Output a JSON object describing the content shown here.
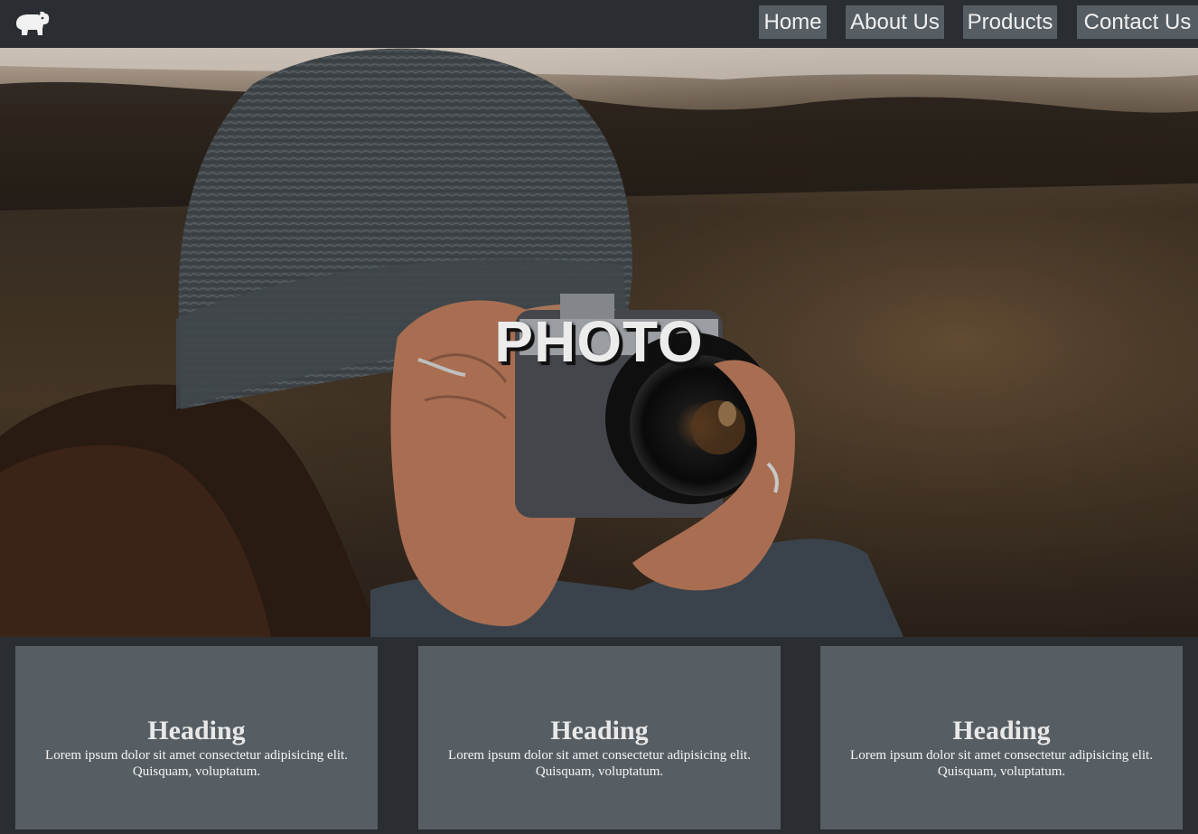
{
  "nav": {
    "links": [
      "Home",
      "About Us",
      "Products",
      "Contact Us"
    ]
  },
  "logo": {
    "icon": "hippo-icon"
  },
  "hero": {
    "title": "PHOTO",
    "image": "person-with-beanie-holding-camera-photo"
  },
  "cards": [
    {
      "heading": "Heading",
      "text": "Lorem ipsum dolor sit amet consectetur adipisicing elit. Quisquam, voluptatum."
    },
    {
      "heading": "Heading",
      "text": "Lorem ipsum dolor sit amet consectetur adipisicing elit. Quisquam, voluptatum."
    },
    {
      "heading": "Heading",
      "text": "Lorem ipsum dolor sit amet consectetur adipisicing elit. Quisquam, voluptatum."
    }
  ],
  "colors": {
    "background": "#2a2d31",
    "nav_button": "#575e63",
    "card": "#575e63",
    "text": "#f0f0f0"
  }
}
